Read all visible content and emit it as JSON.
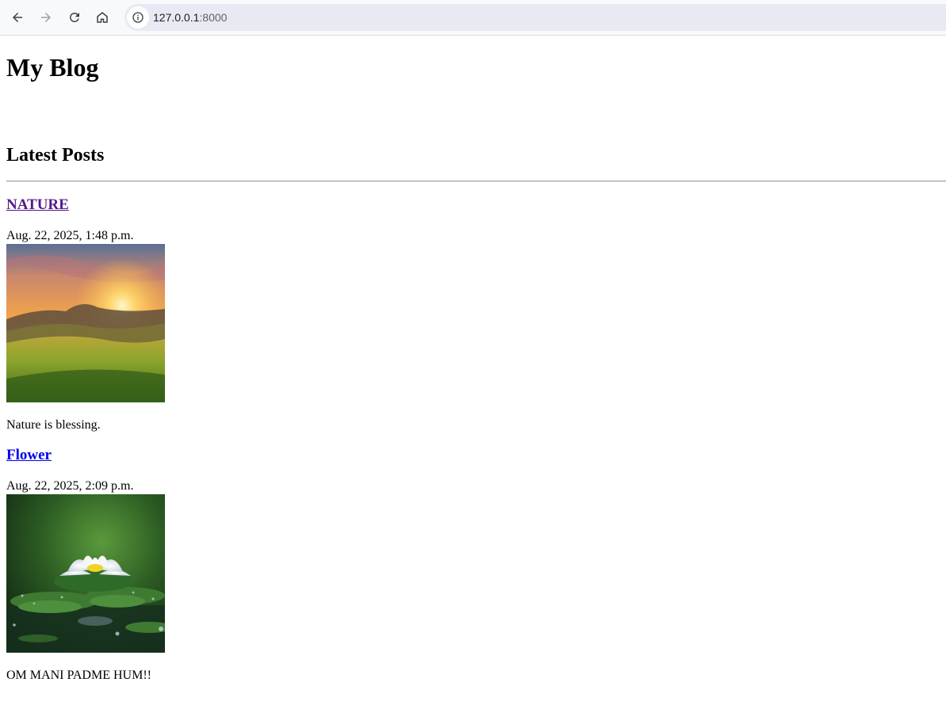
{
  "browser": {
    "url_host": "127.0.0.1",
    "url_port": ":8000",
    "icons": [
      "back-arrow-icon",
      "forward-arrow-icon",
      "reload-icon",
      "home-icon",
      "site-info-icon"
    ]
  },
  "page": {
    "title": "My Blog",
    "section_heading": "Latest Posts"
  },
  "posts": [
    {
      "title": "NATURE",
      "date": "Aug. 22, 2025, 1:48 p.m.",
      "body": "Nature is blessing.",
      "link_state": "visited"
    },
    {
      "title": "Flower",
      "date": "Aug. 22, 2025, 2:09 p.m.",
      "body": "OM MANI PADME HUM!!",
      "link_state": "unvisited"
    }
  ],
  "colors": {
    "visited_link": "#551a8b",
    "unvisited_link": "#0000ee",
    "omnibox_bg": "#e8eaf3"
  }
}
